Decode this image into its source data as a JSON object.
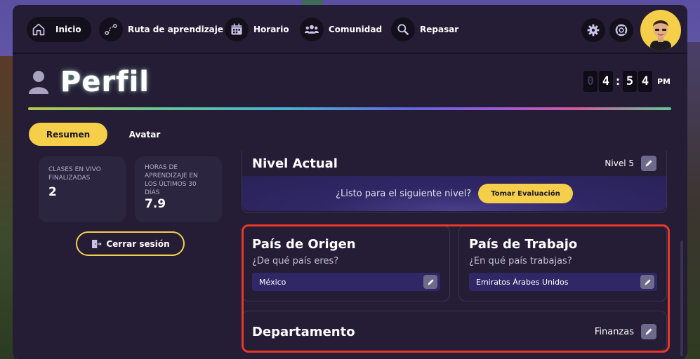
{
  "nav": {
    "items": [
      {
        "label": "Inicio",
        "icon": "home-icon"
      },
      {
        "label": "Ruta de aprendizaje",
        "icon": "route-icon"
      },
      {
        "label": "Horario",
        "icon": "calendar-icon"
      },
      {
        "label": "Comunidad",
        "icon": "community-icon"
      },
      {
        "label": "Repasar",
        "icon": "search-icon"
      }
    ]
  },
  "header": {
    "title": "Perfil",
    "clock": {
      "h1": "0",
      "h2": "4",
      "m1": "5",
      "m2": "4",
      "ampm": "PM"
    }
  },
  "tabs": {
    "resumen": "Resumen",
    "avatar": "Avatar"
  },
  "stats": [
    {
      "label": "CLASES EN VIVO FINALIZADAS",
      "value": "2"
    },
    {
      "label": "HORAS DE APRENDIZAJE EN LOS ÚLTIMOS 30 DÍAS",
      "value": "7.9"
    }
  ],
  "logout_label": "Cerrar sesión",
  "nivel": {
    "title": "Nivel Actual",
    "value": "Nivel 5",
    "prompt": "¿Listo para el siguiente nivel?",
    "button": "Tomar Evaluación"
  },
  "origen": {
    "title": "País de Origen",
    "question": "¿De qué país eres?",
    "value": "México"
  },
  "trabajo": {
    "title": "País de Trabajo",
    "question": "¿En qué país trabajas?",
    "value": "Emiratos Árabes Unidos"
  },
  "departamento": {
    "title": "Departamento",
    "value": "Finanzas"
  },
  "colors": {
    "accent": "#f5cf4a",
    "panel": "#241d35",
    "highlight": "#e8382a"
  }
}
